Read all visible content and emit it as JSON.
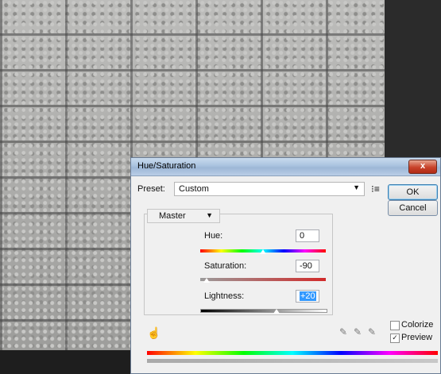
{
  "dialog": {
    "title": "Hue/Saturation",
    "close_label": "x",
    "preset_label": "Preset:",
    "preset_value": "Custom",
    "ok_label": "OK",
    "cancel_label": "Cancel",
    "channel_value": "Master",
    "hue_label": "Hue:",
    "hue_value": "0",
    "saturation_label": "Saturation:",
    "saturation_value": "-90",
    "lightness_label": "Lightness:",
    "lightness_value": "+20",
    "colorize_label": "Colorize",
    "colorize_checked": false,
    "preview_label": "Preview",
    "preview_checked": true
  },
  "icons": {
    "close": "close-icon",
    "dropdown": "chevron-down-icon",
    "preset_menu": "list-menu-icon",
    "hand": "hand-icon",
    "eyedroppers": [
      "eyedropper-icon",
      "eyedropper-plus-icon",
      "eyedropper-minus-icon"
    ]
  }
}
